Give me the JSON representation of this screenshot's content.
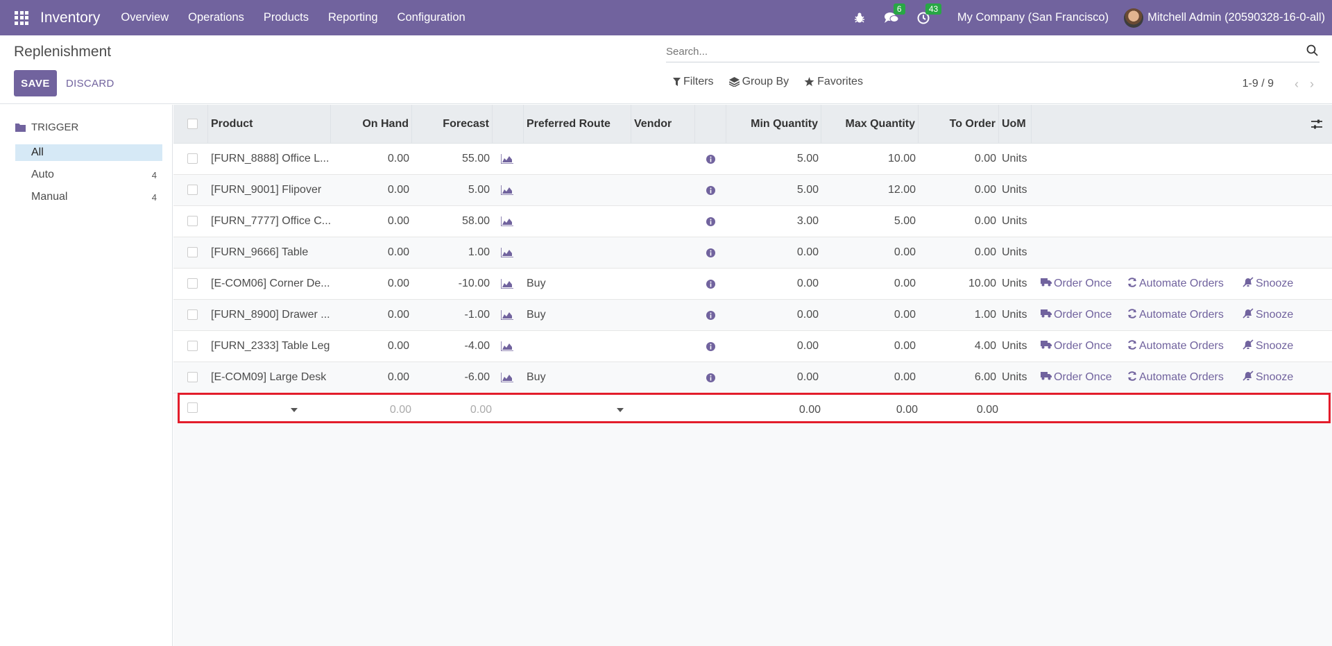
{
  "navbar": {
    "app_name": "Inventory",
    "menu": [
      "Overview",
      "Operations",
      "Products",
      "Reporting",
      "Configuration"
    ],
    "messages_count": "6",
    "activities_count": "43",
    "company": "My Company (San Francisco)",
    "user": "Mitchell Admin (20590328-16-0-all)"
  },
  "control": {
    "title": "Replenishment",
    "save_label": "SAVE",
    "discard_label": "DISCARD",
    "search_placeholder": "Search...",
    "filters_label": "Filters",
    "group_by_label": "Group By",
    "favorites_label": "Favorites",
    "pager": "1-9 / 9"
  },
  "sidebar": {
    "header": "TRIGGER",
    "items": [
      {
        "label": "All",
        "count": ""
      },
      {
        "label": "Auto",
        "count": "4"
      },
      {
        "label": "Manual",
        "count": "4"
      }
    ]
  },
  "table": {
    "headers": {
      "product": "Product",
      "on_hand": "On Hand",
      "forecast": "Forecast",
      "preferred_route": "Preferred Route",
      "vendor": "Vendor",
      "min_qty": "Min Quantity",
      "max_qty": "Max Quantity",
      "to_order": "To Order",
      "uom": "UoM"
    },
    "actions": {
      "order_once": "Order Once",
      "automate_orders": "Automate Orders",
      "snooze": "Snooze"
    },
    "rows": [
      {
        "product": "[FURN_8888] Office L...",
        "on_hand": "0.00",
        "forecast": "55.00",
        "route": "",
        "min": "5.00",
        "max": "10.00",
        "to_order": "0.00",
        "uom": "Units",
        "show_actions": false
      },
      {
        "product": "[FURN_9001] Flipover",
        "on_hand": "0.00",
        "forecast": "5.00",
        "route": "",
        "min": "5.00",
        "max": "12.00",
        "to_order": "0.00",
        "uom": "Units",
        "show_actions": false
      },
      {
        "product": "[FURN_7777] Office C...",
        "on_hand": "0.00",
        "forecast": "58.00",
        "route": "",
        "min": "3.00",
        "max": "5.00",
        "to_order": "0.00",
        "uom": "Units",
        "show_actions": false
      },
      {
        "product": "[FURN_9666] Table",
        "on_hand": "0.00",
        "forecast": "1.00",
        "route": "",
        "min": "0.00",
        "max": "0.00",
        "to_order": "0.00",
        "uom": "Units",
        "show_actions": false
      },
      {
        "product": "[E-COM06] Corner De...",
        "on_hand": "0.00",
        "forecast": "-10.00",
        "route": "Buy",
        "min": "0.00",
        "max": "0.00",
        "to_order": "10.00",
        "uom": "Units",
        "show_actions": true
      },
      {
        "product": "[FURN_8900] Drawer ...",
        "on_hand": "0.00",
        "forecast": "-1.00",
        "route": "Buy",
        "min": "0.00",
        "max": "0.00",
        "to_order": "1.00",
        "uom": "Units",
        "show_actions": true
      },
      {
        "product": "[FURN_2333] Table Leg",
        "on_hand": "0.00",
        "forecast": "-4.00",
        "route": "",
        "min": "0.00",
        "max": "0.00",
        "to_order": "4.00",
        "uom": "Units",
        "show_actions": true
      },
      {
        "product": "[E-COM09] Large Desk",
        "on_hand": "0.00",
        "forecast": "-6.00",
        "route": "Buy",
        "min": "0.00",
        "max": "0.00",
        "to_order": "6.00",
        "uom": "Units",
        "show_actions": true
      }
    ],
    "new_row": {
      "on_hand": "0.00",
      "forecast": "0.00",
      "min": "0.00",
      "max": "0.00",
      "to_order": "0.00"
    }
  }
}
